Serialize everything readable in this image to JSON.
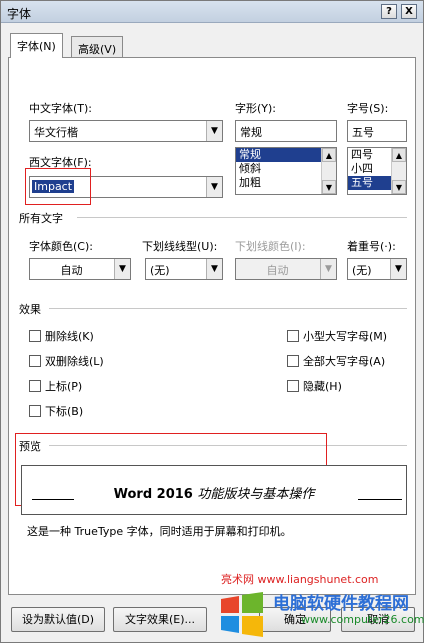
{
  "window": {
    "title": "字体",
    "help_button": "?",
    "close_button": "X"
  },
  "tabs": [
    {
      "label": "字体(N)"
    },
    {
      "label": "高级(V)"
    }
  ],
  "chinese_font": {
    "label": "中文字体(T):",
    "value": "华文行楷"
  },
  "font_style": {
    "label": "字形(Y):",
    "value": "常规",
    "options": [
      "常规",
      "倾斜",
      "加粗"
    ],
    "selected": "常规"
  },
  "font_size": {
    "label": "字号(S):",
    "value": "五号",
    "options": [
      "四号",
      "小四",
      "五号"
    ],
    "selected": "五号"
  },
  "western_font": {
    "label": "西文字体(F):",
    "value": "Impact"
  },
  "all_text": {
    "section_label": "所有文字",
    "font_color": {
      "label": "字体颜色(C):",
      "value": "自动"
    },
    "underline_style": {
      "label": "下划线线型(U):",
      "value": "(无)"
    },
    "underline_color": {
      "label": "下划线颜色(I):",
      "value": "自动"
    },
    "emphasis_mark": {
      "label": "着重号(·):",
      "value": "(无)"
    }
  },
  "effects": {
    "section_label": "效果",
    "left": [
      "删除线(K)",
      "双删除线(L)",
      "上标(P)",
      "下标(B)"
    ],
    "right": [
      "小型大写字母(M)",
      "全部大写字母(A)",
      "隐藏(H)"
    ]
  },
  "preview": {
    "section_label": "预览",
    "sample_text_latin": "Word 2016",
    "sample_text_cjk": "功能版块与基本操作",
    "description": "这是一种 TrueType 字体，同时适用于屏幕和打印机。"
  },
  "buttons": {
    "set_default": "设为默认值(D)",
    "text_effects": "文字效果(E)...",
    "ok": "确定",
    "cancel": "取消"
  },
  "watermark": {
    "site": "亮术网 www.liangshunet.com",
    "brand": "电脑软硬件教程网",
    "url": "www.computer26.com"
  }
}
